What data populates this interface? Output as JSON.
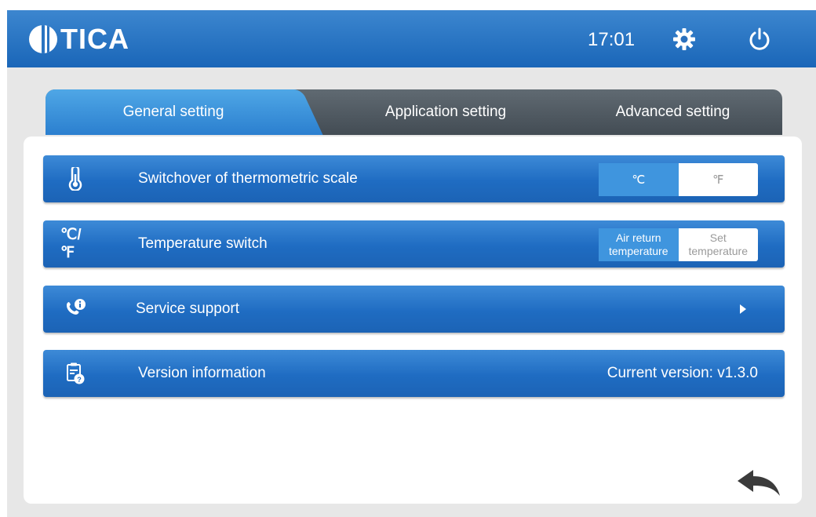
{
  "header": {
    "brand": "TICA",
    "time": "17:01",
    "settings_icon": "gear-icon",
    "power_icon": "power-icon"
  },
  "tabs": [
    {
      "label": "General setting",
      "active": true
    },
    {
      "label": "Application setting",
      "active": false
    },
    {
      "label": "Advanced setting",
      "active": false
    }
  ],
  "rows": {
    "scale": {
      "label": "Switchover of thermometric scale",
      "icon": "thermometer-icon",
      "options": [
        "℃",
        "℉"
      ],
      "selected": "℃"
    },
    "temp_switch": {
      "label": "Temperature switch",
      "icon_text": "℃/℉",
      "options": [
        "Air return\ntemperature",
        "Set\ntemperature"
      ],
      "selected": "Air return temperature"
    },
    "service": {
      "label": "Service support",
      "icon": "phone-info-icon"
    },
    "version": {
      "label": "Version information",
      "icon": "clipboard-help-icon",
      "value": "Current version: v1.3.0"
    }
  },
  "colors": {
    "header": "#1a66b8",
    "row": "#1f6cc2",
    "tab_active": "#2b7fcf",
    "tab_inactive": "#434c54"
  }
}
